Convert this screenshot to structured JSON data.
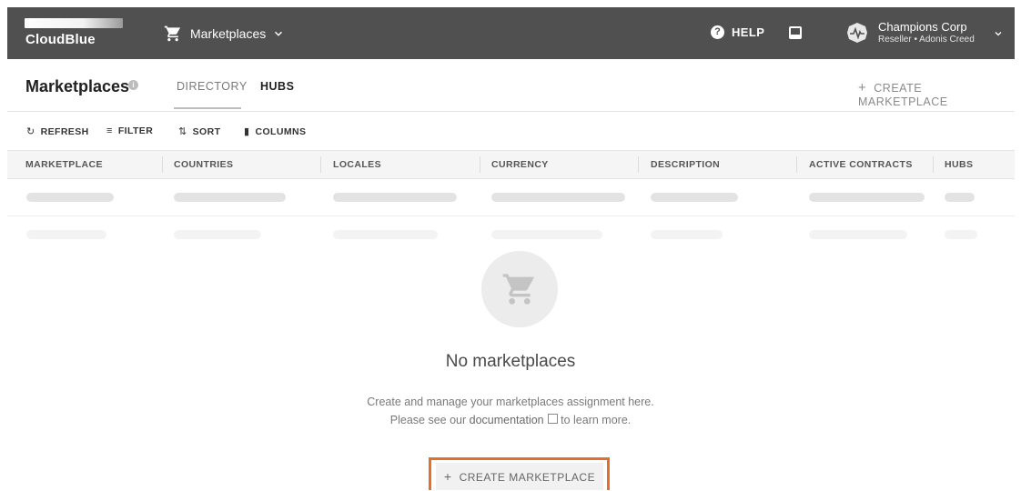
{
  "topbar": {
    "logo_text": "CloudBlue",
    "marketplace_switch_label": "Marketplaces",
    "help_label": "HELP",
    "account": {
      "name": "Champions Corp",
      "subtitle": "Reseller • Adonis Creed"
    }
  },
  "page": {
    "title": "Marketplaces",
    "tabs": [
      {
        "label": "DIRECTORY"
      },
      {
        "label": "HUBS"
      }
    ],
    "create_button": "CREATE MARKETPLACE"
  },
  "toolbar": {
    "refresh": "REFRESH",
    "filter": "FILTER",
    "sort": "SORT",
    "columns": "COLUMNS"
  },
  "table": {
    "columns": [
      "MARKETPLACE",
      "COUNTRIES",
      "LOCALES",
      "CURRENCY",
      "DESCRIPTION",
      "ACTIVE CONTRACTS",
      "HUBS"
    ]
  },
  "empty_state": {
    "title": "No marketplaces",
    "line1": "Create and manage your marketplaces assignment here.",
    "line2_before": "Please see our",
    "link": "documentation",
    "line2_after": "to learn more.",
    "button": "CREATE MARKETPLACE"
  },
  "colors": {
    "topbar": "#505050",
    "highlight": "#e0712a"
  },
  "icons": [
    "cart-icon",
    "chevron-down-icon",
    "help-icon",
    "inbox-icon",
    "account-avatar-icon",
    "info-icon",
    "plus-icon",
    "refresh-icon",
    "filter-icon",
    "sort-icon",
    "columns-icon",
    "external-link-icon"
  ]
}
